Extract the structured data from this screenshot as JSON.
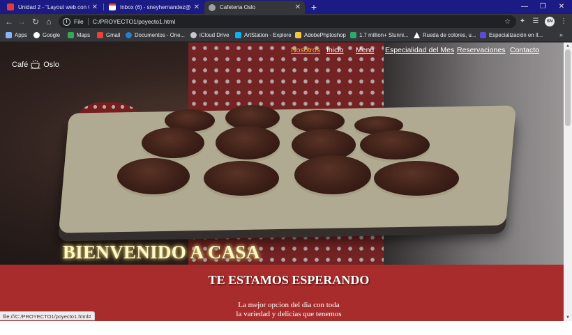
{
  "tabs": [
    {
      "title": "Unidad 2 - \"Layout web con CSS",
      "favicon_color": "#e23b3b"
    },
    {
      "title": "Inbox (6) - sneyhernandez@gmai",
      "favicon_color": "#ffffff"
    },
    {
      "title": "Cafeteria Oslo",
      "favicon_color": "#9aa0a6"
    }
  ],
  "address": {
    "scheme": "File",
    "url": "C:/PROYECTO1/poyecto1.html"
  },
  "bookmarks": [
    {
      "label": "Apps",
      "color": "#8ab4f8"
    },
    {
      "label": "Google",
      "color": "#ffffff"
    },
    {
      "label": "Maps",
      "color": "#34a853"
    },
    {
      "label": "Gmail",
      "color": "#ea4335"
    },
    {
      "label": "Documentos - One...",
      "color": "#2b7cd3"
    },
    {
      "label": "iCloud Drive",
      "color": "#c9c9c9"
    },
    {
      "label": "ArtStation - Explore",
      "color": "#13aff0"
    },
    {
      "label": "AdobePhptoshop",
      "color": "#f6c344"
    },
    {
      "label": "1.7 million+ Stunni...",
      "color": "#2fa86b"
    },
    {
      "label": "Rueda de colores, u...",
      "color": "#ffffff"
    },
    {
      "label": "Especialización en Il...",
      "color": "#5b4bd5"
    }
  ],
  "site": {
    "brand_left": "Café",
    "brand_right": "Oslo",
    "menu": [
      "Nosotros",
      "Inicio",
      "Menu",
      "Especialidad del Mes",
      "Reservaciones",
      "Contacto"
    ],
    "hero_title": "BIENVENIDO A CASA",
    "band_title": "TE ESTAMOS ESPERANDO",
    "band_line1": "La mejor opcion del dia con toda",
    "band_line2": "la variedad y delicias que tenemos"
  },
  "statusbar": "file:///C:/PROYECTO1/poyecto1.html#",
  "colors": {
    "menu_active": "#f3b23b",
    "band": "#a92c2c",
    "tabstrip": "#1c1a85"
  }
}
